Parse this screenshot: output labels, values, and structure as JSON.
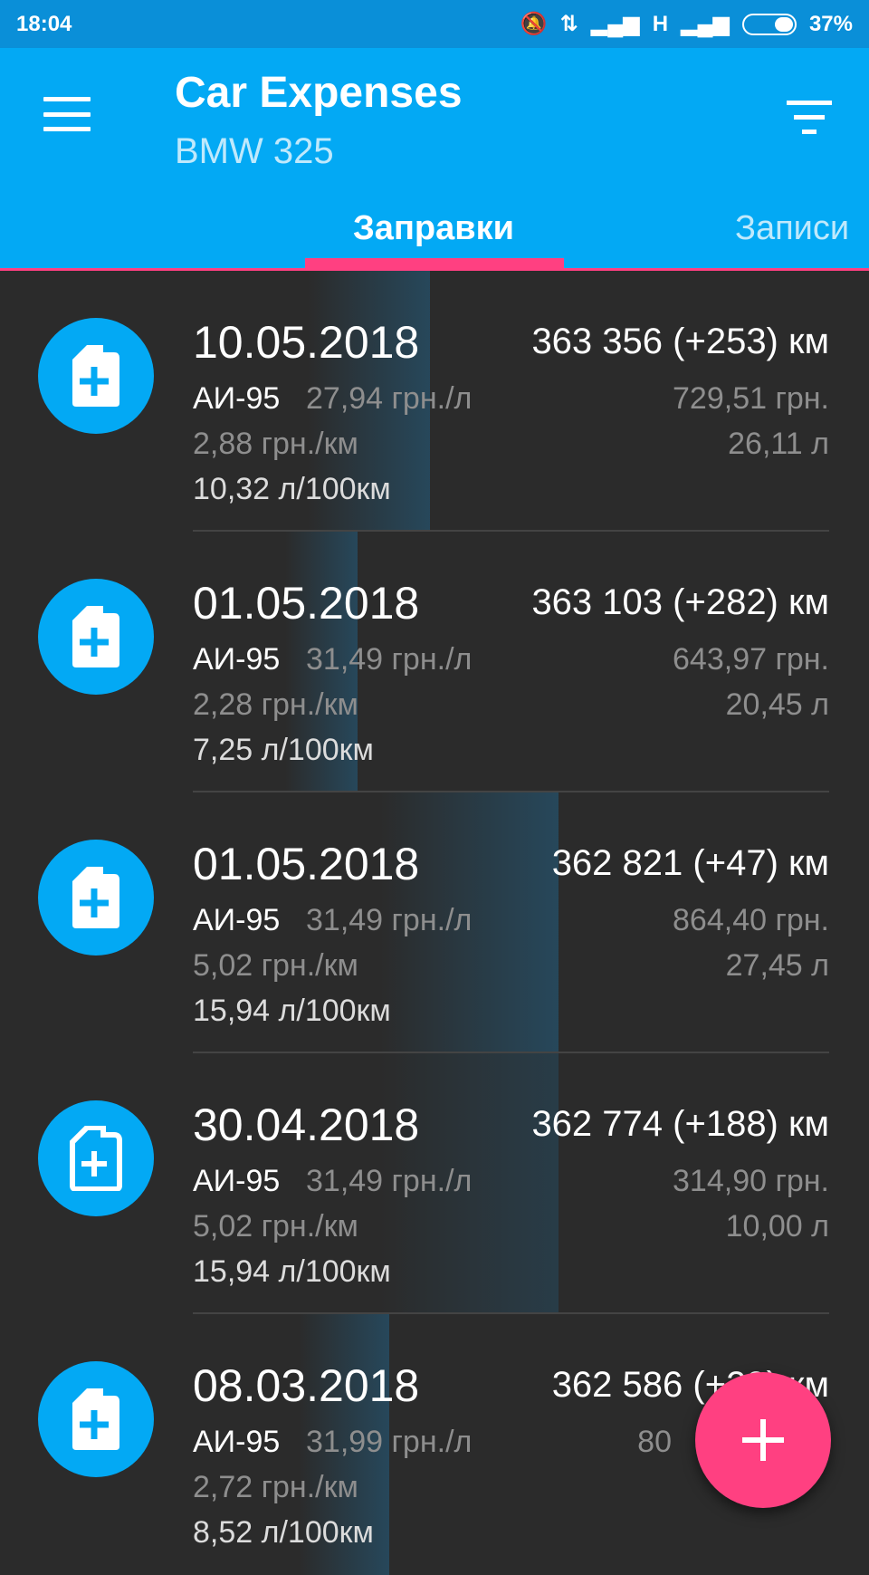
{
  "status": {
    "time": "18:04",
    "network": "H",
    "battery": "37%"
  },
  "app": {
    "title": "Car Expenses",
    "subtitle": "BMW 325"
  },
  "tabs": [
    {
      "label": "Заправки",
      "active": true
    },
    {
      "label": "Записи",
      "active": false
    }
  ],
  "entries": [
    {
      "date": "10.05.2018",
      "odometer": "363 356 (+253) км",
      "fuel_type": "АИ-95",
      "price_per_liter": "27,94 грн./л",
      "cost": "729,51 грн.",
      "cost_per_km": "2,88 грн./км",
      "liters": "26,11 л",
      "consumption": "10,32 л/100км"
    },
    {
      "date": "01.05.2018",
      "odometer": "363 103 (+282) км",
      "fuel_type": "АИ-95",
      "price_per_liter": "31,49 грн./л",
      "cost": "643,97 грн.",
      "cost_per_km": "2,28 грн./км",
      "liters": "20,45 л",
      "consumption": "7,25 л/100км"
    },
    {
      "date": "01.05.2018",
      "odometer": "362 821 (+47) км",
      "fuel_type": "АИ-95",
      "price_per_liter": "31,49 грн./л",
      "cost": "864,40 грн.",
      "cost_per_km": "5,02 грн./км",
      "liters": "27,45 л",
      "consumption": "15,94 л/100км"
    },
    {
      "date": "30.04.2018",
      "odometer": "362 774 (+188) км",
      "fuel_type": "АИ-95",
      "price_per_liter": "31,49 грн./л",
      "cost": "314,90 грн.",
      "cost_per_km": "5,02 грн./км",
      "liters": "10,00 л",
      "consumption": "15,94 л/100км"
    },
    {
      "date": "08.03.2018",
      "odometer": "362 586 (+29) км",
      "fuel_type": "АИ-95",
      "price_per_liter": "31,99 грн./л",
      "cost": "80",
      "cost_per_km": "2,72 грн./км",
      "liters": "",
      "consumption": "8,52 л/100км"
    }
  ],
  "fab": {
    "icon": "plus-icon"
  },
  "colors": {
    "status_bar": "#0a8fd8",
    "app_bar": "#03a9f4",
    "accent": "#ff4081",
    "background": "#2b2b2b"
  }
}
